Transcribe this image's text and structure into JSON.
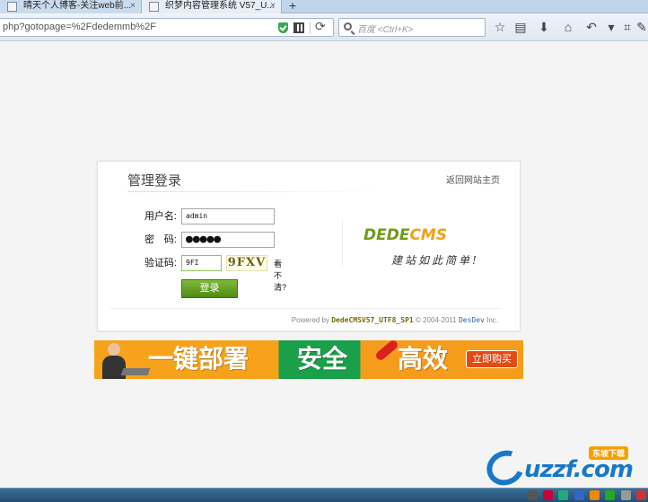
{
  "browser": {
    "tabs": [
      {
        "label": "晴天个人博客-关注web前..."
      },
      {
        "label": "织梦内容管理系统 V57_U..."
      }
    ],
    "new_tab": "+",
    "tab_close": "×",
    "url": "php?gotopage=%2Fdedemmb%2F",
    "search_placeholder": "百度 <Ctrl+K>"
  },
  "login": {
    "title": "管理登录",
    "back_link": "返回网站主页",
    "username_label": "用户名:",
    "username_value": "admin",
    "password_label": "密　码:",
    "password_value": "●●●●●",
    "captcha_label": "验证码:",
    "captcha_value": "9FI",
    "captcha_image": "9FXV",
    "captcha_hint": "看不清?",
    "submit": "登录",
    "logo_left": "DEDE",
    "logo_right": "CMS",
    "slogan": "建站如此简单!",
    "powered_prefix": "Powered by",
    "version": "DedeCMSV57_UTF8_SP1",
    "copyright": "© 2004-2011",
    "org": "DesDev",
    "org_suffix": "Inc."
  },
  "banner": {
    "text1": "一键部署",
    "text2": "安全",
    "text3": "高效",
    "button": "立即购买"
  },
  "watermark": {
    "main": "uzzf.com",
    "badge": "东坡下载"
  },
  "colors": {
    "accent_green": "#4f8b13",
    "banner_orange": "#f7a21b",
    "banner_green": "#1aa04a",
    "watermark_blue": "#1878c8"
  }
}
